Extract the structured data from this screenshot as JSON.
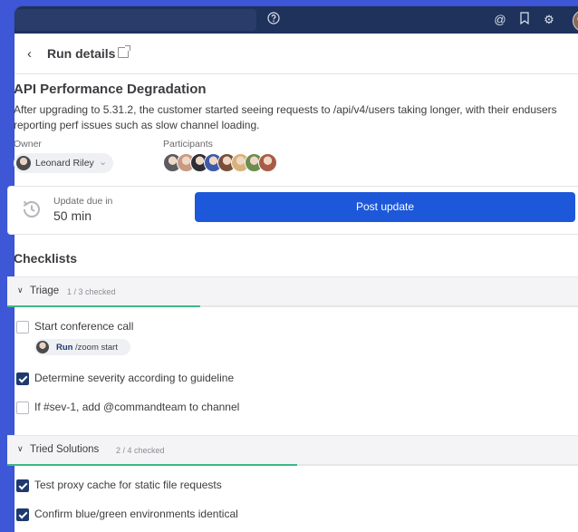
{
  "topbar": {
    "icons": [
      "help-icon",
      "at-mention-icon",
      "bookmark-icon",
      "settings-icon"
    ]
  },
  "header": {
    "title": "Run details"
  },
  "incident": {
    "title": "API Performance Degradation",
    "description": "After upgrading to 5.31.2, the customer started seeing requests to /api/v4/users taking longer, with their endusers reporting perf issues such as slow channel loading.",
    "owner_label": "Owner",
    "owner_name": "Leonard Riley",
    "participants_label": "Participants",
    "participants_count": 8
  },
  "update": {
    "due_label": "Update due in",
    "due_value": "50 min",
    "post_label": "Post update"
  },
  "checklists_title": "Checklists",
  "sections": [
    {
      "name": "Triage",
      "count": "1 / 3 checked",
      "progress": 0.333,
      "items": [
        {
          "text": "Start conference call",
          "checked": false,
          "command_run": "Run",
          "command": "/zoom start"
        },
        {
          "text": "Determine severity according to guideline",
          "checked": true
        },
        {
          "text": "If #sev-1, add @commandteam to channel",
          "checked": false
        }
      ]
    },
    {
      "name": "Tried Solutions",
      "count": "2 / 4 checked",
      "progress": 0.5,
      "items": [
        {
          "text": "Test proxy cache for static file requests",
          "checked": true
        },
        {
          "text": "Confirm blue/green environments identical",
          "checked": true
        }
      ]
    }
  ],
  "colors": {
    "background": "#3d57d6",
    "topbar": "#1e325c",
    "primary_button": "#1c58d9",
    "progress": "#3db887",
    "checkbox_checked": "#1e3a6e"
  }
}
